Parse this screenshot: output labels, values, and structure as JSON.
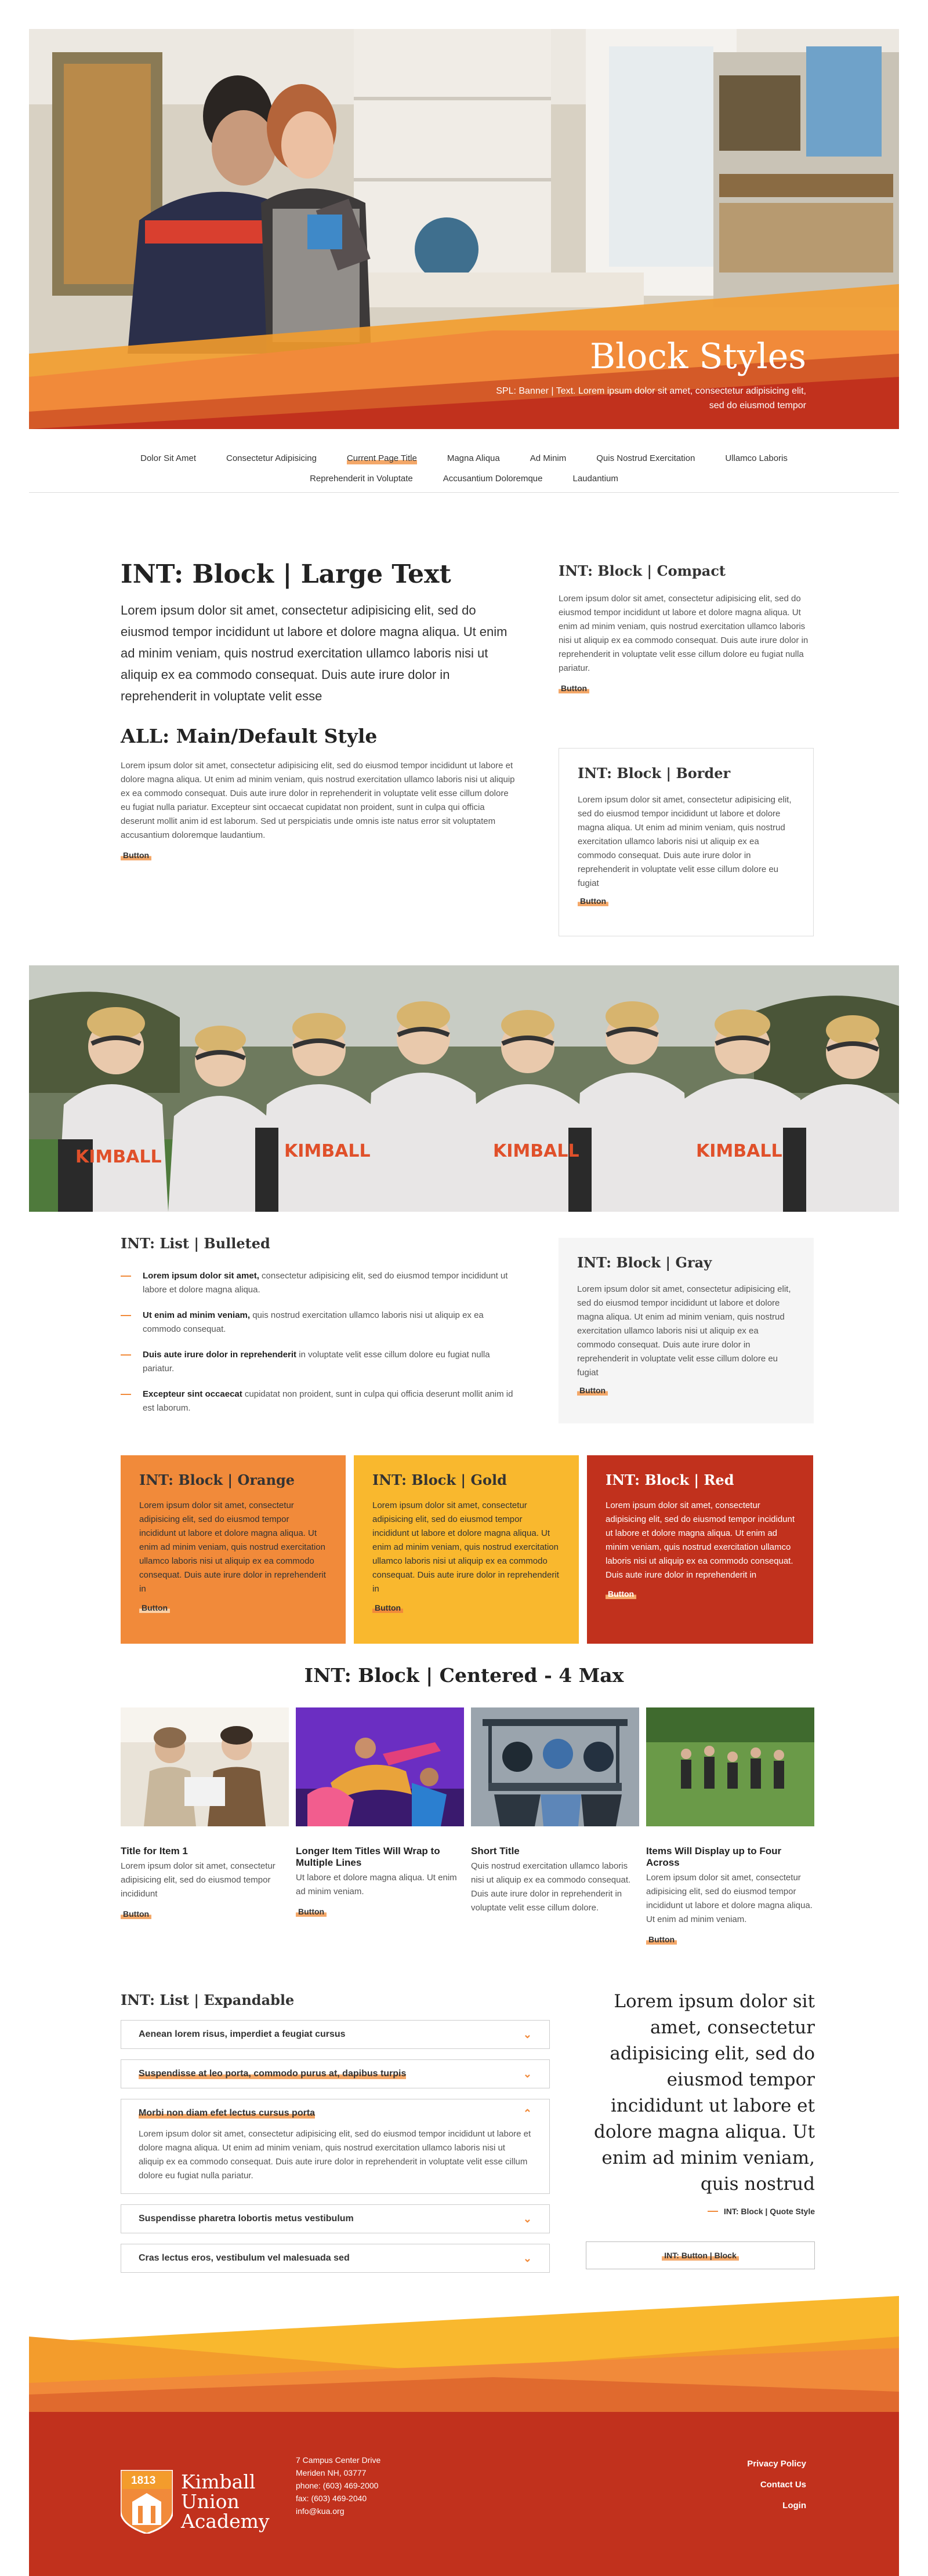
{
  "hero": {
    "title": "Block Styles",
    "subtitle": "SPL: Banner | Text. Lorem ipsum dolor sit amet, consectetur adipisicing elit, sed do eiusmod tempor"
  },
  "nav": {
    "row1": [
      "Dolor Sit Amet",
      "Consectetur Adipisicing",
      "Current Page Title",
      "Magna Aliqua",
      "Ad Minim",
      "Quis Nostrud Exercitation",
      "Ullamco Laboris"
    ],
    "row2": [
      "Reprehenderit in Voluptate",
      "Accusantium Doloremque",
      "Laudantium"
    ],
    "current": "Current Page Title"
  },
  "large": {
    "title": "INT: Block | Large Text",
    "text": "Lorem ipsum dolor sit amet, consectetur adipisicing elit, sed do eiusmod tempor incididunt ut labore et dolore magna aliqua. Ut enim ad minim veniam, quis nostrud exercitation ullamco laboris nisi ut aliquip ex ea commodo consequat. Duis aute irure dolor in reprehenderit in voluptate velit esse"
  },
  "main": {
    "title": "ALL: Main/Default Style",
    "text": "Lorem ipsum dolor sit amet, consectetur adipisicing elit, sed do eiusmod tempor incididunt ut labore et dolore magna aliqua. Ut enim ad minim veniam, quis nostrud exercitation ullamco laboris nisi ut aliquip ex ea commodo consequat. Duis aute irure dolor in reprehenderit in voluptate velit esse cillum dolore eu fugiat nulla pariatur. Excepteur sint occaecat cupidatat non proident, sunt in culpa qui officia deserunt mollit anim id est laborum. Sed ut perspiciatis unde omnis iste natus error sit voluptatem accusantium doloremque laudantium.",
    "button": "Button"
  },
  "compact": {
    "title": "INT: Block | Compact",
    "text": "Lorem ipsum dolor sit amet, consectetur adipisicing elit, sed do eiusmod tempor incididunt ut labore et dolore magna aliqua. Ut enim ad minim veniam, quis nostrud exercitation ullamco laboris nisi ut aliquip ex ea commodo consequat. Duis aute irure dolor in reprehenderit in voluptate velit esse cillum dolore eu fugiat nulla pariatur.",
    "button": "Button"
  },
  "border": {
    "title": "INT: Block | Border",
    "text": "Lorem ipsum dolor sit amet, consectetur adipisicing elit, sed do eiusmod tempor incididunt ut labore et dolore magna aliqua. Ut enim ad minim veniam, quis nostrud exercitation ullamco laboris nisi ut aliquip ex ea commodo consequat. Duis aute irure dolor in reprehenderit in voluptate velit esse cillum dolore eu fugiat",
    "button": "Button"
  },
  "list": {
    "title": "INT: List | Bulleted",
    "items": [
      {
        "bold": "Lorem ipsum dolor sit amet,",
        "rest": " consectetur adipisicing elit, sed do eiusmod tempor incididunt ut labore et dolore magna aliqua."
      },
      {
        "bold": "Ut enim ad minim veniam,",
        "rest": " quis nostrud exercitation ullamco laboris nisi ut aliquip ex ea commodo consequat."
      },
      {
        "bold": "Duis aute irure dolor in reprehenderit",
        "rest": " in voluptate velit esse cillum dolore eu fugiat nulla pariatur."
      },
      {
        "bold": "Excepteur sint occaecat",
        "rest": " cupidatat non proident, sunt in culpa qui officia deserunt mollit anim id est laborum."
      }
    ]
  },
  "gray": {
    "title": "INT: Block | Gray",
    "text": "Lorem ipsum dolor sit amet, consectetur adipisicing elit, sed do eiusmod tempor incididunt ut labore et dolore magna aliqua. Ut enim ad minim veniam, quis nostrud exercitation ullamco laboris nisi ut aliquip ex ea commodo consequat. Duis aute irure dolor in reprehenderit in voluptate velit esse cillum dolore eu fugiat",
    "button": "Button"
  },
  "colored": [
    {
      "title": "INT: Block | Orange",
      "text": "Lorem ipsum dolor sit amet, consectetur adipisicing elit, sed do eiusmod tempor incididunt ut labore et dolore magna aliqua. Ut enim ad minim veniam, quis nostrud exercitation ullamco laboris nisi ut aliquip ex ea commodo consequat. Duis aute irure dolor in reprehenderit in",
      "button": "Button"
    },
    {
      "title": "INT: Block | Gold",
      "text": "Lorem ipsum dolor sit amet, consectetur adipisicing elit, sed do eiusmod tempor incididunt ut labore et dolore magna aliqua. Ut enim ad minim veniam, quis nostrud exercitation ullamco laboris nisi ut aliquip ex ea commodo consequat. Duis aute irure dolor in reprehenderit in",
      "button": "Button"
    },
    {
      "title": "INT: Block | Red",
      "text": "Lorem ipsum dolor sit amet, consectetur adipisicing elit, sed do eiusmod tempor incididunt ut labore et dolore magna aliqua. Ut enim ad minim veniam, quis nostrud exercitation ullamco laboris nisi ut aliquip ex ea commodo consequat. Duis aute irure dolor in reprehenderit in",
      "button": "Button"
    }
  ],
  "centered": {
    "title": "INT: Block | Centered - 4 Max",
    "items": [
      {
        "title": "Title for Item 1",
        "text": "Lorem ipsum dolor sit amet, consectetur adipisicing elit, sed do eiusmod tempor incididunt",
        "button": "Button"
      },
      {
        "title": "Longer Item Titles Will Wrap to Multiple Lines",
        "text": "Ut labore et dolore magna aliqua. Ut enim ad minim veniam.",
        "button": "Button"
      },
      {
        "title": "Short Title",
        "text": "Quis nostrud exercitation ullamco laboris nisi ut aliquip ex ea commodo consequat. Duis aute irure dolor in reprehenderit in voluptate velit esse cillum dolore.",
        "button": "Button"
      },
      {
        "title": "Items Will Display up to Four Across",
        "text": "Lorem ipsum dolor sit amet, consectetur adipisicing elit, sed do eiusmod tempor incididunt ut labore et dolore magna aliqua. Ut enim ad minim veniam.",
        "button": "Button"
      }
    ]
  },
  "expandable": {
    "title": "INT: List | Expandable",
    "items": [
      {
        "label": "Aenean lorem risus, imperdiet a feugiat cursus",
        "highlight": false
      },
      {
        "label": "Suspendisse at leo porta, commodo purus at, dapibus turpis",
        "highlight": true
      },
      {
        "label": "Morbi non diam efet lectus cursus porta",
        "highlight": true,
        "open": true,
        "text": "Lorem ipsum dolor sit amet, consectetur adipisicing elit, sed do eiusmod tempor incididunt ut labore et dolore magna aliqua. Ut enim ad minim veniam, quis nostrud exercitation ullamco laboris nisi ut aliquip ex ea commodo consequat. Duis aute irure dolor in reprehenderit in voluptate velit esse cillum dolore eu fugiat nulla pariatur."
      },
      {
        "label": "Suspendisse pharetra lobortis metus vestibulum",
        "highlight": false
      },
      {
        "label": "Cras lectus eros, vestibulum vel malesuada sed",
        "highlight": false
      }
    ]
  },
  "quote": {
    "text": "Lorem ipsum dolor sit amet, consectetur adipisicing elit, sed do eiusmod tempor incididunt ut labore et dolore magna aliqua. Ut enim ad minim veniam, quis nostrud",
    "attribution": "INT: Block | Quote Style",
    "button": "INT: Button | Block"
  },
  "footer": {
    "logo_year": "1813",
    "logo_line1": "Kimball",
    "logo_line2": "Union",
    "logo_line3": "Academy",
    "address": [
      "7 Campus Center Drive",
      "Meriden NH, 03777",
      "phone: (603) 469-2000",
      "fax: (603) 469-2040",
      "info@kua.org"
    ],
    "links": [
      "Privacy Policy",
      "Contact Us",
      "Login"
    ]
  },
  "colors": {
    "orange": "#f18a3a",
    "gold": "#f9b82e",
    "red": "#c1311d",
    "highlight": "#f4a869"
  }
}
